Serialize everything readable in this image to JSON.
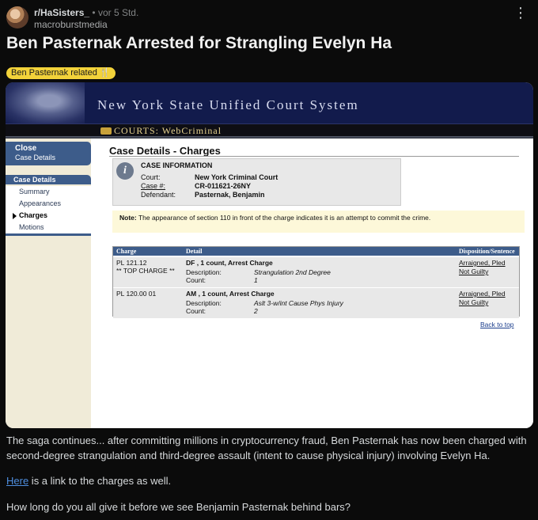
{
  "post": {
    "subreddit": "r/HaSisters_",
    "separator": "•",
    "time": "vor 5 Std.",
    "username": "macroburstmedia",
    "more_icon": "⋮",
    "title": "Ben Pasternak Arrested for Strangling Evelyn Ha",
    "flair": "Ben Pasternak related 🍴",
    "body": {
      "para1": "The saga continues... after committing millions in cryptocurrency fraud, Ben Pasternak has now been charged with second-degree strangulation and third-degree assault (intent to cause physical injury) involving Evelyn Ha.",
      "para2_link": "Here",
      "para2_rest": " is a link to the charges as well.",
      "para3": "How long do you all give it before we see Benjamin Pasternak behind bars?"
    }
  },
  "court": {
    "banner_title": "New York State Unified Court System",
    "courts_label": "COURTS: WebCriminal",
    "sidebar": {
      "close_l1": "Close",
      "close_l2": "Case Details",
      "section": "Case Details",
      "items": [
        "Summary",
        "Appearances",
        "Charges",
        "Motions"
      ]
    },
    "page_heading": "Case Details - Charges",
    "info": {
      "heading": "CASE INFORMATION",
      "court_label": "Court:",
      "court_value": "New York Criminal Court",
      "case_label": "Case #:",
      "case_value": "CR-011621-26NY",
      "defendant_label": "Defendant:",
      "defendant_value": "Pasternak, Benjamin"
    },
    "note_label": "Note:",
    "note_text": " The appearance of section 110 in front of the charge indicates it is an attempt to commit the crime.",
    "table": {
      "headers": [
        "Charge",
        "Detail",
        "Disposition/Sentence"
      ],
      "rows": [
        {
          "charge": "PL 121.12",
          "charge_sub": "** TOP CHARGE **",
          "detail": "DF , 1 count, Arrest Charge",
          "desc_label": "Description:",
          "desc_value": "Strangulation 2nd Degree",
          "count_label": "Count:",
          "count_value": "1",
          "disp1": "Arraigned, Pled",
          "disp2": "Not Guilty"
        },
        {
          "charge": "PL 120.00 01",
          "charge_sub": "",
          "detail": "AM , 1 count, Arrest Charge",
          "desc_label": "Description:",
          "desc_value": "Aslt 3-w/int Cause Phys Injury",
          "count_label": "Count:",
          "count_value": "2",
          "disp1": "Arraigned, Pled",
          "disp2": "Not Guilty"
        }
      ]
    },
    "back_to_top": "Back to top"
  },
  "colors": {
    "background": "#0b0b0b",
    "banner": "#121b4c",
    "nav_blue": "#3d5c8a",
    "flair": "#f2d23a",
    "link": "#4f8fe0"
  }
}
